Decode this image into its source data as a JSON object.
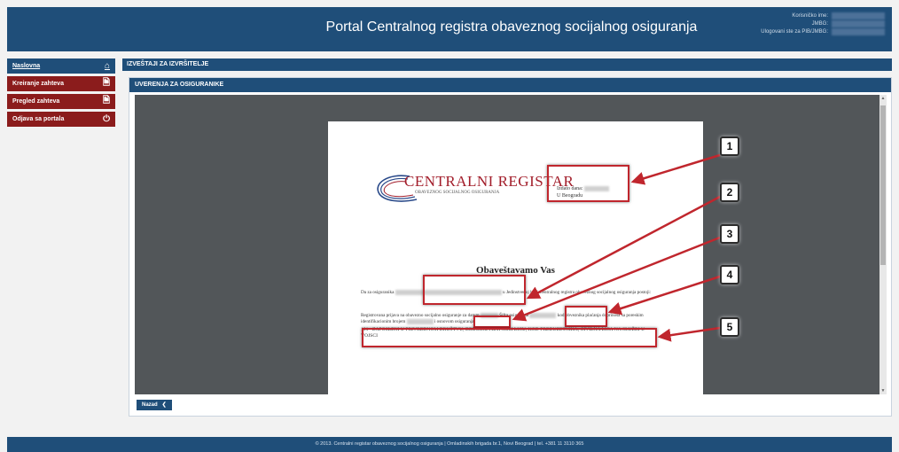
{
  "header": {
    "title": "Portal Centralnog registra obaveznog socijalnog osiguranja",
    "user_labels": [
      "Korisničko ime:",
      "JMBG:",
      "Ulogovani ste za PIB/JMBG:"
    ]
  },
  "sidebar": {
    "items": [
      {
        "label": "Naslovna",
        "icon": "home-icon"
      },
      {
        "label": "Kreiranje zahteva",
        "icon": "document-icon"
      },
      {
        "label": "Pregled zahteva",
        "icon": "document-icon"
      },
      {
        "label": "Odjava sa portala",
        "icon": "power-icon"
      }
    ]
  },
  "section": {
    "title": "IZVEŠTAJI ZA IZVRŠITELJE"
  },
  "panel": {
    "title": "UVERENJA ZA OSIGURANIKE"
  },
  "document": {
    "logo_title": "CENTRALNI REGISTAR",
    "logo_subtitle": "OBAVEZNOG SOCIJALNOG OSIGURANJA",
    "issued_label": "Izdato dana:",
    "issued_place": "U Beogradu",
    "heading": "Obaveštavamo Vas",
    "p1_start": "Da za osiguranika",
    "p1_end": "u Jedinstvenoj bazi Centralnog registra obaveznog socijalnog osiguranja postoji:",
    "p2_start": "Registrovana prijava na obavezno socijalno osiguranje za datum",
    "p2_mid1": "Šifra osiguranja",
    "p2_mid2": "kod obveznika plaćanja doprinosa sa poreskim identifikacionim brojem",
    "p2_end": "i osnovom osiguranja:",
    "p3": "101 - ZAPOSLENI U PRIVREDNOM DRUŠTVU, DRUGOM PRAVNOM LICU, KOD PREDUZETNIKA, CIVILNA LICA NA SLUŽBI U VOJSCI"
  },
  "annotations": [
    "1",
    "2",
    "3",
    "4",
    "5"
  ],
  "buttons": {
    "back": "Nazad"
  },
  "footer": {
    "text": "© 2013. Centralni registar obaveznog socijalnog osiguranja | Omladinskih brigada br.1, Novi Beograd | tel. +381 11 3110 365"
  },
  "colors": {
    "brand": "#1f4e79",
    "nav_red": "#8b1c1c",
    "annotation": "#c0262d"
  }
}
